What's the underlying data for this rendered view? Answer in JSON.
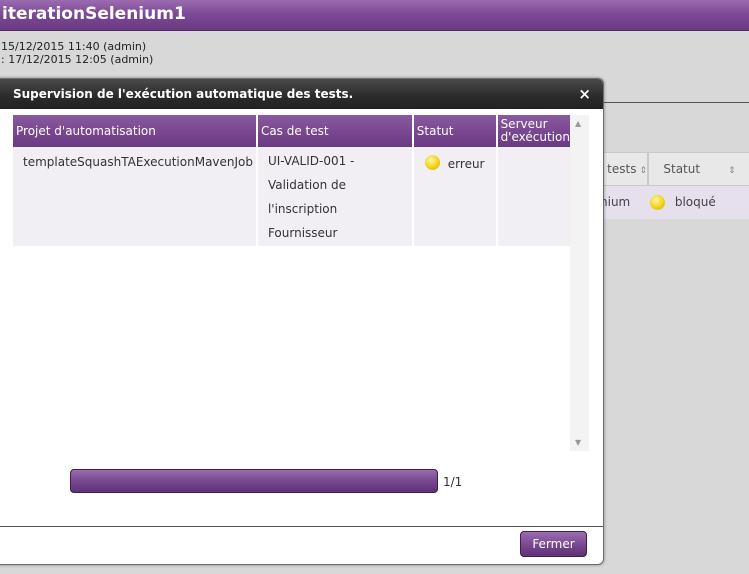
{
  "page": {
    "title": "iterationSelenium1",
    "meta_line1": "15/12/2015 11:40 (admin)",
    "meta_line2": ":  17/12/2015 12:05 (admin)"
  },
  "background_table": {
    "columns": [
      "tests",
      "Statut"
    ],
    "row": {
      "col1": "nium",
      "status": "bloqué"
    }
  },
  "modal": {
    "title": "Supervision de l'exécution automatique des tests.",
    "close_symbol": "×",
    "columns": {
      "project": "Projet d'automatisation",
      "test_case": "Cas de test",
      "status": "Statut",
      "server_line1": "Serveur",
      "server_line2": "d'exécution"
    },
    "rows": [
      {
        "project": "templateSquashTAExecutionMavenJob",
        "test_case_lines": [
          "UI-VALID-001 -",
          "Validation de",
          "l'inscription",
          "Fournisseur"
        ],
        "status": "erreur",
        "server": ""
      }
    ],
    "progress": {
      "value": 1.0,
      "label": "1/1"
    },
    "close_button": "Fermer"
  },
  "colors": {
    "accent": "#7d4a95",
    "status_dot": "#f2d11a",
    "modal_header": "#2a2a2a"
  },
  "icons": {
    "close": "close-icon",
    "status": "status-dot-icon",
    "sort": "sort-icon"
  }
}
